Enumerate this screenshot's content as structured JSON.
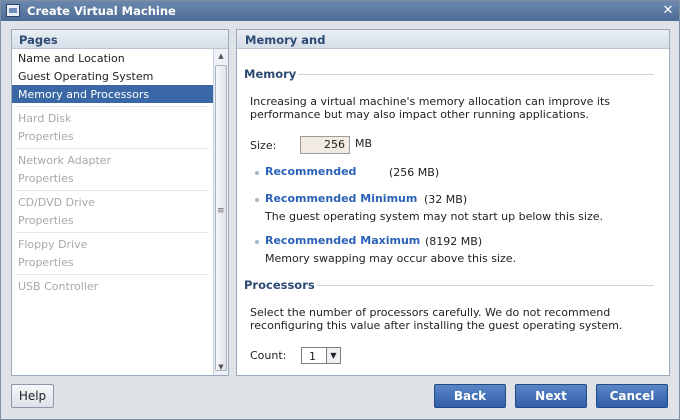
{
  "window": {
    "title": "Create Virtual Machine",
    "close_glyph": "✕"
  },
  "sidebar": {
    "header": "Pages",
    "items": [
      {
        "label": "Name and Location"
      },
      {
        "label": "Guest Operating System"
      },
      {
        "label": "Memory and Processors"
      },
      {
        "label": "Hard Disk"
      },
      {
        "label": "Properties"
      },
      {
        "label": "Network Adapter"
      },
      {
        "label": "Properties"
      },
      {
        "label": "CD/DVD Drive"
      },
      {
        "label": "Properties"
      },
      {
        "label": "Floppy Drive"
      },
      {
        "label": "Properties"
      },
      {
        "label": "USB Controller"
      }
    ],
    "scroll_up_glyph": "▲",
    "scroll_down_glyph": "▼",
    "thumb_grip_glyph": "≡"
  },
  "main": {
    "header": "Memory and",
    "memory": {
      "title": "Memory",
      "desc_line1": "Increasing a virtual machine's memory allocation can improve its",
      "desc_line2": "performance but may also impact other running applications.",
      "size_label": "Size:",
      "size_value": "256",
      "size_unit": "MB",
      "recommended_label": "Recommended",
      "recommended_value": "(256 MB)",
      "rec_min_label": "Recommended Minimum",
      "rec_min_value": "(32 MB)",
      "rec_min_note": "The guest operating system may not start up below this size.",
      "rec_max_label": "Recommended Maximum",
      "rec_max_value": "(8192 MB)",
      "rec_max_note": "Memory swapping may occur above this size."
    },
    "processors": {
      "title": "Processors",
      "desc_line1": "Select the number of processors carefully. We do not recommend",
      "desc_line2": "reconfiguring this value after installing the guest operating system.",
      "count_label": "Count:",
      "count_value": "1",
      "dropdown_glyph": "▼"
    }
  },
  "footer": {
    "help": "Help",
    "back": "Back",
    "next": "Next",
    "cancel": "Cancel"
  },
  "colors": {
    "accent": "#3a68a6",
    "link": "#2a62b8",
    "section_title": "#2c4a72"
  }
}
